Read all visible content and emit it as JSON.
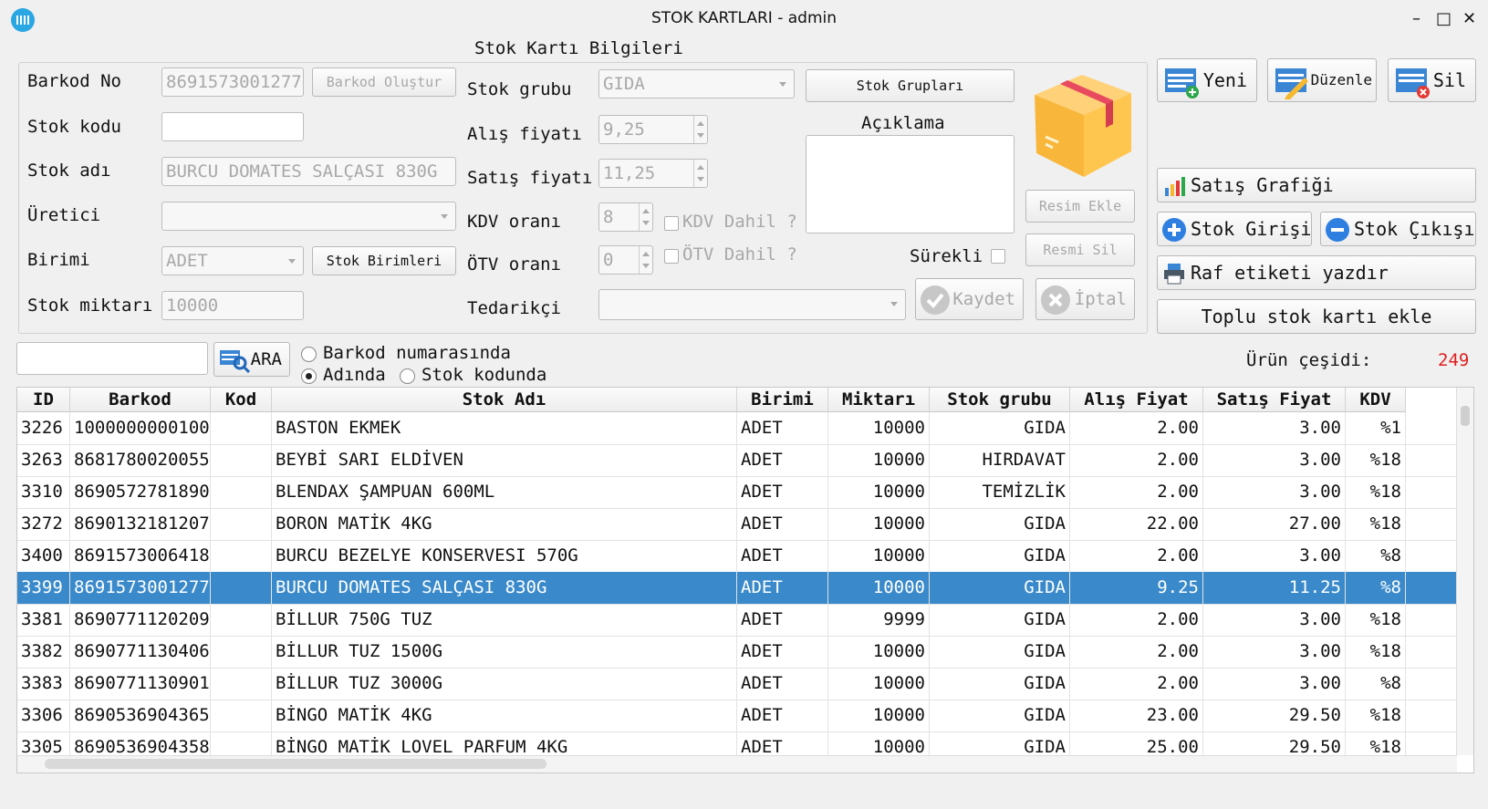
{
  "window": {
    "title": "STOK KARTLARI - admin",
    "minimize": "–",
    "maximize": "□",
    "close": "✕"
  },
  "section_title": "Stok Kartı Bilgileri",
  "form": {
    "barkod_label": "Barkod No",
    "barkod_value": "8691573001277",
    "barkod_button": "Barkod Oluştur",
    "stok_kodu_label": "Stok kodu",
    "stok_kodu_value": "",
    "stok_adi_label": "Stok adı",
    "stok_adi_value": "BURCU DOMATES SALÇASI 830G",
    "uretici_label": "Üretici",
    "uretici_value": "",
    "birimi_label": "Birimi",
    "birimi_value": "ADET",
    "birimi_button": "Stok Birimleri",
    "stok_miktari_label": "Stok miktarı",
    "stok_miktari_value": "10000",
    "stok_grubu_label": "Stok grubu",
    "stok_grubu_value": "GIDA",
    "stok_gruplari_button": "Stok Grupları",
    "alis_label": "Alış fiyatı",
    "alis_value": "9,25",
    "satis_label": "Satış fiyatı",
    "satis_value": "11,25",
    "kdv_label": "KDV oranı",
    "kdv_value": "8",
    "kdv_dahil": "KDV Dahil ?",
    "otv_label": "ÖTV oranı",
    "otv_value": "0",
    "otv_dahil": "ÖTV Dahil ?",
    "tedarikci_label": "Tedarikçi",
    "tedarikci_value": "",
    "aciklama_label": "Açıklama",
    "aciklama_value": "",
    "surekli_label": "Sürekli",
    "resim_ekle": "Resim Ekle",
    "resmi_sil": "Resmi Sil",
    "kaydet": "Kaydet",
    "iptal": "İptal"
  },
  "actions": {
    "yeni": "Yeni",
    "duzenle": "Düzenle",
    "sil": "Sil",
    "satis_grafigi": "Satış Grafiği",
    "stok_girisi": "Stok Girişi",
    "stok_cikisi": "Stok Çıkışı",
    "raf_etiketi": "Raf etiketi yazdır",
    "toplu": "Toplu stok kartı ekle"
  },
  "search": {
    "value": "",
    "button": "ARA",
    "opt_barkod": "Barkod numarasında",
    "opt_adinda": "Adında",
    "opt_kod": "Stok kodunda",
    "selected": "Adında"
  },
  "urun_cesidi_label": "Ürün çeşidi:",
  "urun_cesidi_value": "249",
  "colors": {
    "selection": "#3a8acb",
    "count": "#e02020"
  },
  "table": {
    "columns": [
      "ID",
      "Barkod",
      "Kod",
      "Stok Adı",
      "Birimi",
      "Miktarı",
      "Stok grubu",
      "Alış Fiyat",
      "Satış Fiyat",
      "KDV"
    ],
    "rows": [
      [
        "3226",
        "1000000000100",
        "",
        "BASTON EKMEK",
        "ADET",
        "10000",
        "GIDA",
        "2.00",
        "3.00",
        "%1"
      ],
      [
        "3263",
        "8681780020055",
        "",
        "BEYBİ SARI ELDİVEN",
        "ADET",
        "10000",
        "HIRDAVAT",
        "2.00",
        "3.00",
        "%18"
      ],
      [
        "3310",
        "8690572781890",
        "",
        "BLENDAX ŞAMPUAN 600ML",
        "ADET",
        "10000",
        "TEMİZLİK",
        "2.00",
        "3.00",
        "%18"
      ],
      [
        "3272",
        "8690132181207",
        "",
        "BORON MATİK 4KG",
        "ADET",
        "10000",
        "GIDA",
        "22.00",
        "27.00",
        "%18"
      ],
      [
        "3400",
        "8691573006418",
        "",
        "BURCU BEZELYE KONSERVESI 570G",
        "ADET",
        "10000",
        "GIDA",
        "2.00",
        "3.00",
        "%8"
      ],
      [
        "3399",
        "8691573001277",
        "",
        "BURCU DOMATES SALÇASI 830G",
        "ADET",
        "10000",
        "GIDA",
        "9.25",
        "11.25",
        "%8"
      ],
      [
        "3381",
        "8690771120209",
        "",
        "BİLLUR 750G TUZ",
        "ADET",
        "9999",
        "GIDA",
        "2.00",
        "3.00",
        "%18"
      ],
      [
        "3382",
        "8690771130406",
        "",
        "BİLLUR TUZ 1500G",
        "ADET",
        "10000",
        "GIDA",
        "2.00",
        "3.00",
        "%18"
      ],
      [
        "3383",
        "8690771130901",
        "",
        "BİLLUR TUZ 3000G",
        "ADET",
        "10000",
        "GIDA",
        "2.00",
        "3.00",
        "%8"
      ],
      [
        "3306",
        "8690536904365",
        "",
        "BİNGO MATİK 4KG",
        "ADET",
        "10000",
        "GIDA",
        "23.00",
        "29.50",
        "%18"
      ],
      [
        "3305",
        "8690536904358",
        "",
        "BİNGO MATİK LOVEL PARFUM 4KG",
        "ADET",
        "10000",
        "GIDA",
        "25.00",
        "29.50",
        "%18"
      ]
    ],
    "selected_index": 5
  }
}
